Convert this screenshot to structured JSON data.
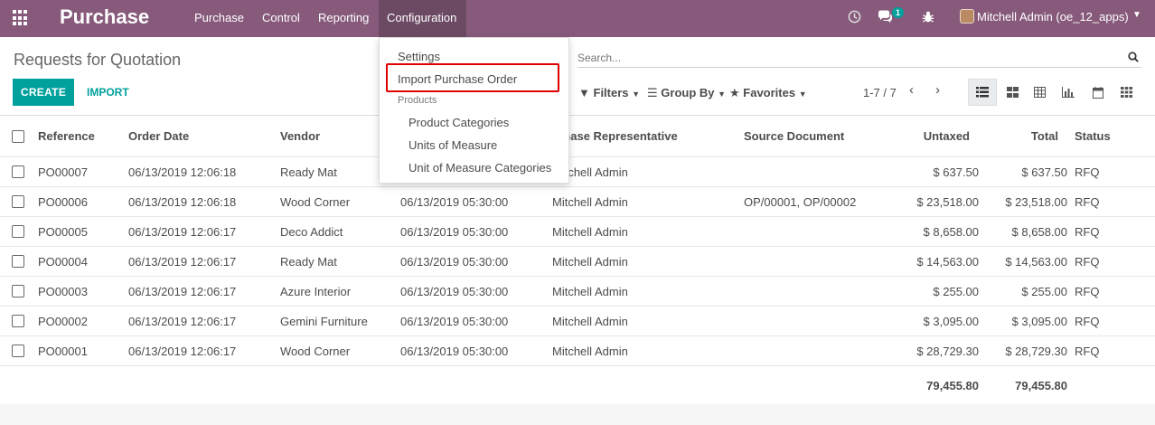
{
  "nav": {
    "app_title": "Purchase",
    "menu": [
      "Purchase",
      "Control",
      "Reporting",
      "Configuration"
    ],
    "messages_count": "1",
    "user": "Mitchell Admin (oe_12_apps)"
  },
  "config_menu": {
    "settings": "Settings",
    "import_po": "Import Purchase Order",
    "products_header": "Products",
    "product_categories": "Product Categories",
    "units_of_measure": "Units of Measure",
    "uom_categories": "Unit of Measure Categories"
  },
  "control": {
    "title": "Requests for Quotation",
    "create": "CREATE",
    "import": "IMPORT",
    "search_placeholder": "Search...",
    "filters": "Filters",
    "group_by": "Group By",
    "favorites": "Favorites",
    "pager": "1-7 / 7"
  },
  "table": {
    "headers": {
      "reference": "Reference",
      "order_date": "Order Date",
      "vendor": "Vendor",
      "rep": "Purchase Representative",
      "rep_visible": "rchase Representative",
      "source": "Source Document",
      "untaxed": "Untaxed",
      "total": "Total",
      "status": "Status"
    },
    "rows": [
      {
        "ref": "PO00007",
        "order_date": "06/13/2019 12:06:18",
        "vendor": "Ready Mat",
        "sched": "",
        "rep": "Mitchell Admin",
        "source": "",
        "untaxed": "$ 637.50",
        "total": "$ 637.50",
        "status": "RFQ"
      },
      {
        "ref": "PO00006",
        "order_date": "06/13/2019 12:06:18",
        "vendor": "Wood Corner",
        "sched": "06/13/2019 05:30:00",
        "rep": "Mitchell Admin",
        "source": "OP/00001, OP/00002",
        "untaxed": "$ 23,518.00",
        "total": "$ 23,518.00",
        "status": "RFQ"
      },
      {
        "ref": "PO00005",
        "order_date": "06/13/2019 12:06:17",
        "vendor": "Deco Addict",
        "sched": "06/13/2019 05:30:00",
        "rep": "Mitchell Admin",
        "source": "",
        "untaxed": "$ 8,658.00",
        "total": "$ 8,658.00",
        "status": "RFQ"
      },
      {
        "ref": "PO00004",
        "order_date": "06/13/2019 12:06:17",
        "vendor": "Ready Mat",
        "sched": "06/13/2019 05:30:00",
        "rep": "Mitchell Admin",
        "source": "",
        "untaxed": "$ 14,563.00",
        "total": "$ 14,563.00",
        "status": "RFQ"
      },
      {
        "ref": "PO00003",
        "order_date": "06/13/2019 12:06:17",
        "vendor": "Azure Interior",
        "sched": "06/13/2019 05:30:00",
        "rep": "Mitchell Admin",
        "source": "",
        "untaxed": "$ 255.00",
        "total": "$ 255.00",
        "status": "RFQ"
      },
      {
        "ref": "PO00002",
        "order_date": "06/13/2019 12:06:17",
        "vendor": "Gemini Furniture",
        "sched": "06/13/2019 05:30:00",
        "rep": "Mitchell Admin",
        "source": "",
        "untaxed": "$ 3,095.00",
        "total": "$ 3,095.00",
        "status": "RFQ"
      },
      {
        "ref": "PO00001",
        "order_date": "06/13/2019 12:06:17",
        "vendor": "Wood Corner",
        "sched": "06/13/2019 05:30:00",
        "rep": "Mitchell Admin",
        "source": "",
        "untaxed": "$ 28,729.30",
        "total": "$ 28,729.30",
        "status": "RFQ"
      }
    ],
    "footer": {
      "untaxed": "79,455.80",
      "total": "79,455.80"
    }
  },
  "colors": {
    "brand": "#875a7b",
    "accent": "#00a09d",
    "highlight": "#e00000"
  }
}
